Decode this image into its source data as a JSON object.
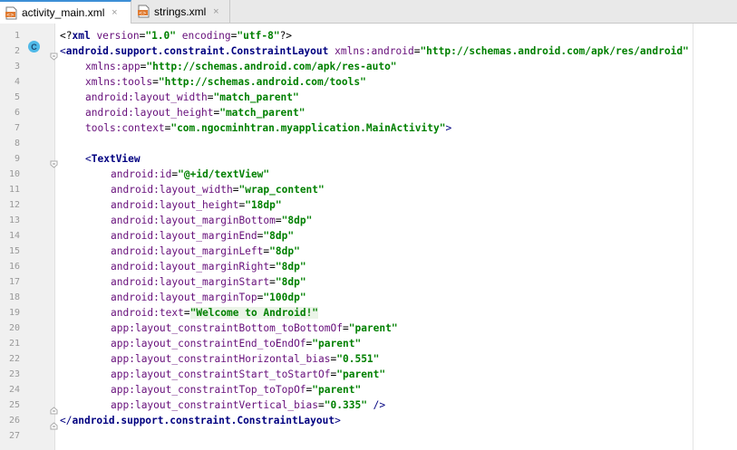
{
  "tabs": [
    {
      "label": "activity_main.xml",
      "active": true,
      "close": "×"
    },
    {
      "label": "strings.xml",
      "active": false,
      "close": "×"
    }
  ],
  "gutter": {
    "line_numbers": [
      "1",
      "2",
      "3",
      "4",
      "5",
      "6",
      "7",
      "8",
      "9",
      "10",
      "11",
      "12",
      "13",
      "14",
      "15",
      "16",
      "17",
      "18",
      "19",
      "20",
      "21",
      "22",
      "23",
      "24",
      "25",
      "26",
      "27"
    ],
    "badge": "C"
  },
  "code": {
    "l1": {
      "open": "<?",
      "name": "xml",
      "a1": " version",
      "eq1": "=",
      "v1": "\"1.0\"",
      "a2": " encoding",
      "eq2": "=",
      "v2": "\"utf-8\"",
      "close": "?>"
    },
    "l2": {
      "open": "<",
      "tag": "android.support.constraint.ConstraintLayout",
      "ns": " xmlns:",
      "attr": "android",
      "eq": "=",
      "val": "\"http://schemas.android.com/apk/res/android\""
    },
    "l3": {
      "ns": "xmlns:",
      "attr": "app",
      "eq": "=",
      "val": "\"http://schemas.android.com/apk/res-auto\""
    },
    "l4": {
      "ns": "xmlns:",
      "attr": "tools",
      "eq": "=",
      "val": "\"http://schemas.android.com/tools\""
    },
    "l5": {
      "ns": "android:",
      "attr": "layout_width",
      "eq": "=",
      "val": "\"match_parent\""
    },
    "l6": {
      "ns": "android:",
      "attr": "layout_height",
      "eq": "=",
      "val": "\"match_parent\""
    },
    "l7": {
      "ns": "tools:",
      "attr": "context",
      "eq": "=",
      "val": "\"com.ngocminhtran.myapplication.MainActivity\"",
      "close": ">"
    },
    "l9": {
      "open": "<",
      "tag": "TextView"
    },
    "l10": {
      "ns": "android:",
      "attr": "id",
      "eq": "=",
      "val": "\"@+id/textView\""
    },
    "l11": {
      "ns": "android:",
      "attr": "layout_width",
      "eq": "=",
      "val": "\"wrap_content\""
    },
    "l12": {
      "ns": "android:",
      "attr": "layout_height",
      "eq": "=",
      "val": "\"18dp\""
    },
    "l13": {
      "ns": "android:",
      "attr": "layout_marginBottom",
      "eq": "=",
      "val": "\"8dp\""
    },
    "l14": {
      "ns": "android:",
      "attr": "layout_marginEnd",
      "eq": "=",
      "val": "\"8dp\""
    },
    "l15": {
      "ns": "android:",
      "attr": "layout_marginLeft",
      "eq": "=",
      "val": "\"8dp\""
    },
    "l16": {
      "ns": "android:",
      "attr": "layout_marginRight",
      "eq": "=",
      "val": "\"8dp\""
    },
    "l17": {
      "ns": "android:",
      "attr": "layout_marginStart",
      "eq": "=",
      "val": "\"8dp\""
    },
    "l18": {
      "ns": "android:",
      "attr": "layout_marginTop",
      "eq": "=",
      "val": "\"100dp\""
    },
    "l19": {
      "ns": "android:",
      "attr": "text",
      "eq": "=",
      "val": "\"Welcome to Android!\""
    },
    "l20": {
      "ns": "app:",
      "attr": "layout_constraintBottom_toBottomOf",
      "eq": "=",
      "val": "\"parent\""
    },
    "l21": {
      "ns": "app:",
      "attr": "layout_constraintEnd_toEndOf",
      "eq": "=",
      "val": "\"parent\""
    },
    "l22": {
      "ns": "app:",
      "attr": "layout_constraintHorizontal_bias",
      "eq": "=",
      "val": "\"0.551\""
    },
    "l23": {
      "ns": "app:",
      "attr": "layout_constraintStart_toStartOf",
      "eq": "=",
      "val": "\"parent\""
    },
    "l24": {
      "ns": "app:",
      "attr": "layout_constraintTop_toTopOf",
      "eq": "=",
      "val": "\"parent\""
    },
    "l25": {
      "ns": "app:",
      "attr": "layout_constraintVertical_bias",
      "eq": "=",
      "val": "\"0.335\"",
      "close": " />"
    },
    "l26": {
      "open": "</",
      "tag": "android.support.constraint.ConstraintLayout",
      "close": ">"
    }
  },
  "colors": {
    "tag": "#000080",
    "attribute": "#660e7a",
    "string": "#008000",
    "tab_accent": "#3d8fd6",
    "badge": "#4fb9e8"
  }
}
